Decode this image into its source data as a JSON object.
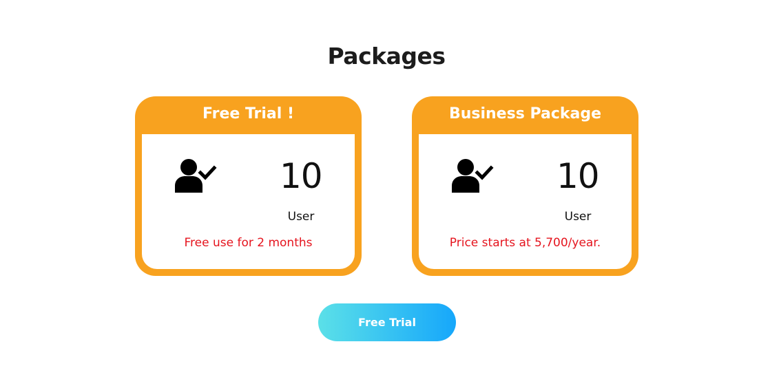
{
  "page": {
    "title": "Packages"
  },
  "packages": [
    {
      "name": "Free Trial !",
      "users_count": "10",
      "users_label": "User",
      "note": "Free use for 2 months",
      "icon": "user-check-icon"
    },
    {
      "name": "Business Package",
      "users_count": "10",
      "users_label": "User",
      "note": "Price starts at 5,700/year.",
      "icon": "user-check-icon"
    }
  ],
  "cta": {
    "label": "Free Trial"
  },
  "colors": {
    "card": "#f8a21f",
    "note": "#e5141e",
    "cta_gradient_start": "#5be0e8",
    "cta_gradient_end": "#16a7fb"
  }
}
